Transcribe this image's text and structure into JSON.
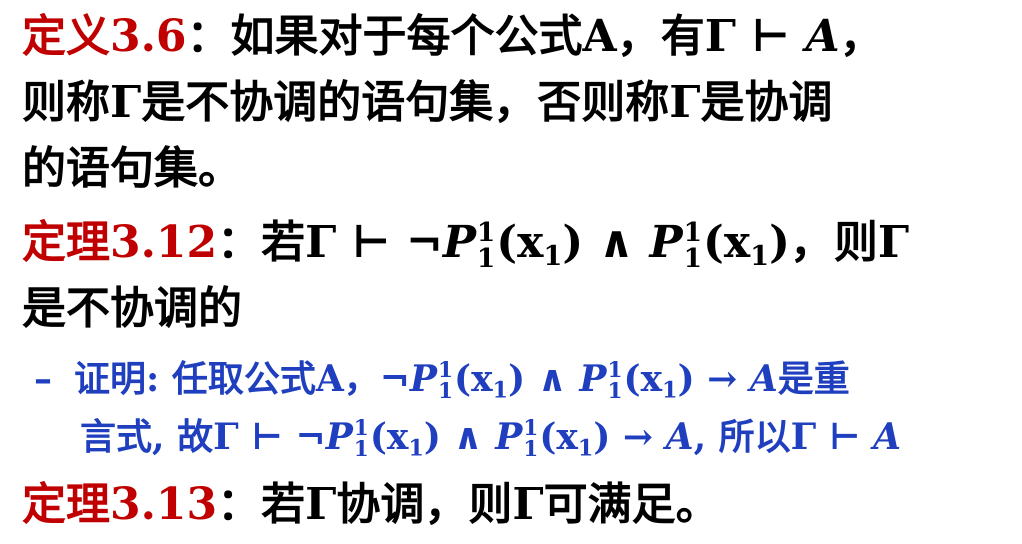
{
  "def36": {
    "label": "定义3.6",
    "line1": "：如果对于每个公式A，有Γ ⊢ ",
    "line1_A": "A",
    "line1_end": "，",
    "line2": "则称Γ是不协调的语句集，否则称Γ是协调",
    "line3": "的语句集。"
  },
  "thm312": {
    "label": "定理3.12",
    "line1_pre": "：若Γ ⊢ ¬",
    "P": "P",
    "sup": "1",
    "sub": "1",
    "arg": "(x",
    "argsub": "1",
    "argend": ")",
    "and": " ∧ ",
    "line1_end": "，则Γ",
    "line2": "是不协调的"
  },
  "proof": {
    "dash": "–",
    "line1_pre": "证明: 任取公式A，¬",
    "arrow_A": " → ",
    "A": "A",
    "line1_end": "是重",
    "line2_pre": "言式, 故Γ ⊢ ¬",
    "line2_mid": ", 所以Γ ⊢ ",
    "A2": "A"
  },
  "thm313": {
    "label": "定理3.13",
    "text": "：若Γ协调，则Γ可满足。"
  }
}
